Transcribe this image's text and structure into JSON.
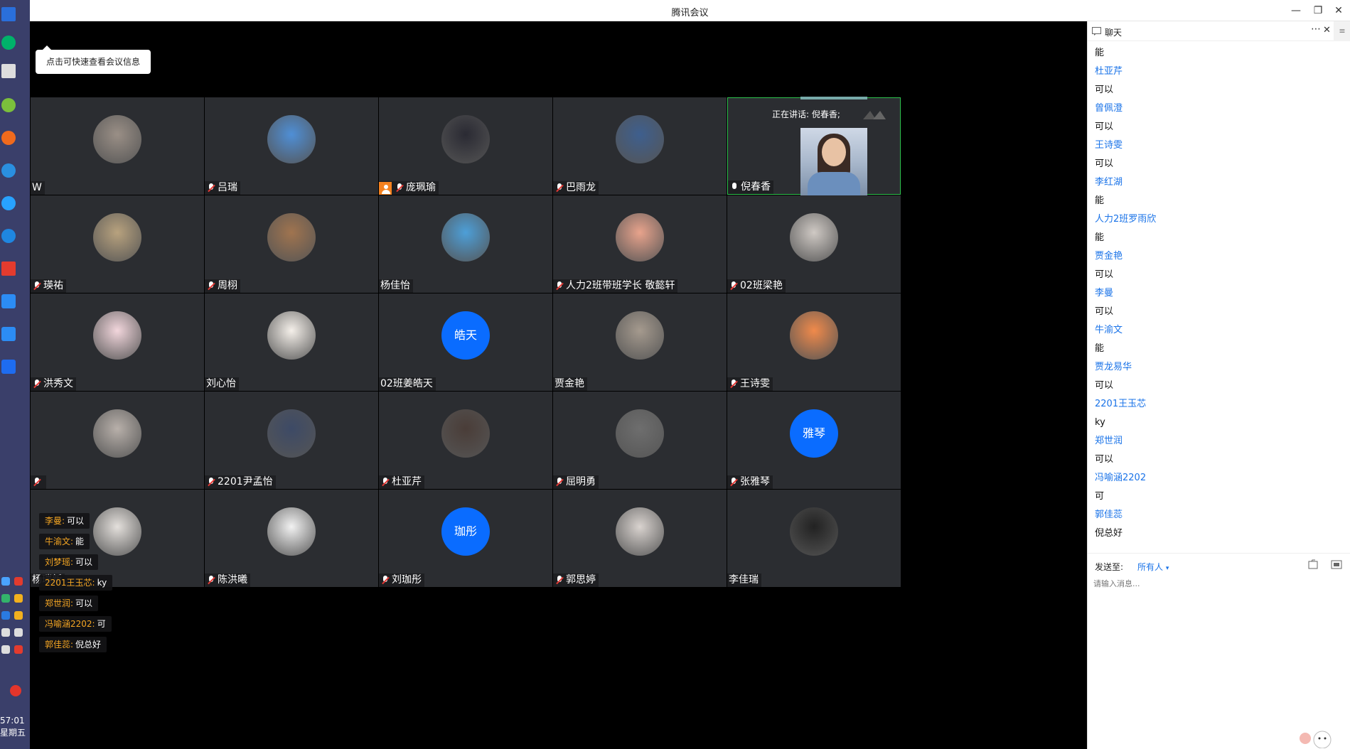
{
  "app": {
    "title": "腾讯会议"
  },
  "window_controls": {
    "minimize": "—",
    "restore": "❐",
    "close": "✕"
  },
  "taskbar": {
    "clock_time": "57:01",
    "clock_day": "星期五"
  },
  "meeting_tip": "点击可快速查看会议信息",
  "speaking": {
    "label": "正在讲话: 倪春香;"
  },
  "tiles": [
    {
      "name": "W",
      "mic": "none",
      "avatar_color": "#9a8f86"
    },
    {
      "name": "吕瑞",
      "mic": "muted",
      "avatar_color": "#4f8fd6"
    },
    {
      "name": "庞珮瑜",
      "mic": "muted",
      "host": true,
      "avatar_color": "#2a2a33"
    },
    {
      "name": "巴雨龙",
      "mic": "muted",
      "avatar_color": "#3e5f8e"
    },
    {
      "name": "倪春香",
      "mic": "on",
      "active": true
    },
    {
      "name": "瑛祐",
      "mic": "muted",
      "avatar_color": "#b8a27e"
    },
    {
      "name": "周栩",
      "mic": "muted",
      "avatar_color": "#a0744f"
    },
    {
      "name": "杨佳怡",
      "mic": "none",
      "avatar_color": "#4d9fd8"
    },
    {
      "name": "人力2班带班学长 敬懿轩",
      "mic": "muted",
      "avatar_color": "#e8a38c"
    },
    {
      "name": "02班梁艳",
      "mic": "muted",
      "avatar_color": "#cfc9c4"
    },
    {
      "name": "洪秀文",
      "mic": "muted",
      "avatar_color": "#f2d6dc"
    },
    {
      "name": "刘心怡",
      "mic": "none",
      "avatar_color": "#f5f0ea"
    },
    {
      "name": "02班姜皓天",
      "mic": "none",
      "avatar_text": "皓天"
    },
    {
      "name": "贾金艳",
      "mic": "none",
      "avatar_color": "#a59a8e"
    },
    {
      "name": "王诗雯",
      "mic": "muted",
      "avatar_color": "#f08a4b"
    },
    {
      "name": "",
      "mic": "muted",
      "avatar_color": "#b8b0aa"
    },
    {
      "name": "2201尹孟怡",
      "mic": "muted",
      "avatar_color": "#3d4a66"
    },
    {
      "name": "杜亚芹",
      "mic": "muted",
      "avatar_color": "#4a3d38"
    },
    {
      "name": "屈明勇",
      "mic": "muted",
      "avatar_color": "#6e6e6e"
    },
    {
      "name": "张雅琴",
      "mic": "muted",
      "avatar_text": "雅琴"
    },
    {
      "name": "杨瑞新",
      "mic": "none",
      "avatar_color": "#e4e0dc"
    },
    {
      "name": "陈洪曦",
      "mic": "muted",
      "avatar_color": "#f2f2f2"
    },
    {
      "name": "刘珈彤",
      "mic": "muted",
      "avatar_text": "珈彤"
    },
    {
      "name": "郭思婷",
      "mic": "muted",
      "avatar_color": "#d9d3cf"
    },
    {
      "name": "李佳瑞",
      "mic": "none",
      "avatar_color": "#222"
    }
  ],
  "overlay_bubbles": [
    {
      "who": "李曼:",
      "text": "可以"
    },
    {
      "who": "牛渝文:",
      "text": "能"
    },
    {
      "who": "刘梦瑶:",
      "text": "可以"
    },
    {
      "who": "2201王玉芯:",
      "text": "ky"
    },
    {
      "who": "郑世润:",
      "text": "可以"
    },
    {
      "who": "冯喻涵2202:",
      "text": "可"
    },
    {
      "who": "郭佳蕊:",
      "text": "倪总好"
    }
  ],
  "chat": {
    "title": "聊天",
    "messages": [
      {
        "type": "text",
        "value": "能"
      },
      {
        "type": "sender",
        "value": "杜亚芹"
      },
      {
        "type": "text",
        "value": "可以"
      },
      {
        "type": "sender",
        "value": "曾佩澄"
      },
      {
        "type": "text",
        "value": "可以"
      },
      {
        "type": "sender",
        "value": "王诗雯"
      },
      {
        "type": "text",
        "value": "可以"
      },
      {
        "type": "sender",
        "value": "李红湖"
      },
      {
        "type": "text",
        "value": "能"
      },
      {
        "type": "sender",
        "value": "人力2班罗雨欣"
      },
      {
        "type": "text",
        "value": "能"
      },
      {
        "type": "sender",
        "value": "贾金艳"
      },
      {
        "type": "text",
        "value": "可以"
      },
      {
        "type": "sender",
        "value": "李曼"
      },
      {
        "type": "text",
        "value": "可以"
      },
      {
        "type": "sender",
        "value": "牛渝文"
      },
      {
        "type": "text",
        "value": "能"
      },
      {
        "type": "sender",
        "value": "贾龙易华"
      },
      {
        "type": "text",
        "value": "可以"
      },
      {
        "type": "sender",
        "value": "2201王玉芯"
      },
      {
        "type": "text",
        "value": "ky"
      },
      {
        "type": "sender",
        "value": "郑世润"
      },
      {
        "type": "text",
        "value": "可以"
      },
      {
        "type": "sender",
        "value": "冯喻涵2202"
      },
      {
        "type": "text",
        "value": "可"
      },
      {
        "type": "sender",
        "value": "郭佳蕊"
      },
      {
        "type": "text",
        "value": "倪总好"
      }
    ],
    "send_to_label": "发送至:",
    "send_to_value": "所有人",
    "input_placeholder": "请输入消息..."
  },
  "colors": {
    "tile_bg": "#2b2d31",
    "active_border": "#2ec24d",
    "sender_blue": "#1a73e8",
    "avatar_blue": "#0a6cff"
  }
}
